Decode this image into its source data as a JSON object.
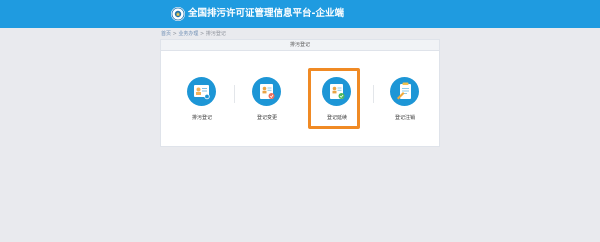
{
  "header": {
    "title": "全国排污许可证管理信息平台-企业端",
    "logo_icon": "emblem-icon",
    "background": "#1f9be0"
  },
  "breadcrumb": {
    "items": [
      "首页",
      "业务办理",
      "排污登记"
    ],
    "separator": ">"
  },
  "panel": {
    "title": "排污登记"
  },
  "cards": [
    {
      "label": "排污登记",
      "icon": "registration-icon",
      "selected": false
    },
    {
      "label": "登记变更",
      "icon": "change-icon",
      "selected": false
    },
    {
      "label": "登记延续",
      "icon": "renewal-icon",
      "selected": true
    },
    {
      "label": "登记注销",
      "icon": "cancel-icon",
      "selected": false
    }
  ],
  "colors": {
    "icon_circle": "#1d96d6",
    "selection_border": "#f08a24",
    "page_background": "#e9eaee"
  }
}
